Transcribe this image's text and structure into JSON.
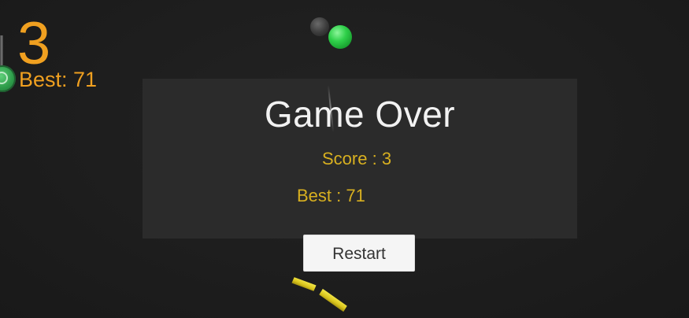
{
  "hud": {
    "score": "3",
    "best_label": "Best: ",
    "best_value": "71",
    "color": "#f0a020"
  },
  "game_over_panel": {
    "title": "Game Over",
    "score_label": "Score : ",
    "score_value": "3",
    "best_label": "Best : ",
    "best_value": "71",
    "text_color": "#d8b020"
  },
  "restart_button": {
    "label": "Restart"
  },
  "scene": {
    "background": "#1d1d1d",
    "ball_colors": [
      "#3a3a3a",
      "#2fd04a"
    ],
    "shard_color": "#e6d52a"
  }
}
